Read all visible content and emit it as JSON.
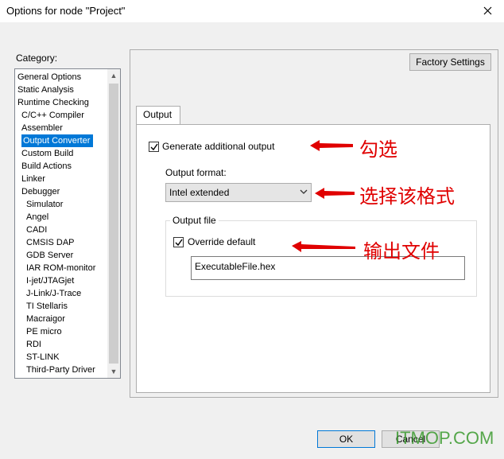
{
  "window": {
    "title": "Options for node \"Project\"",
    "close_icon": "close-icon"
  },
  "sidebar": {
    "label": "Category:",
    "items": [
      {
        "label": "General Options",
        "indent": 0
      },
      {
        "label": "Static Analysis",
        "indent": 0
      },
      {
        "label": "Runtime Checking",
        "indent": 0
      },
      {
        "label": "C/C++ Compiler",
        "indent": 1
      },
      {
        "label": "Assembler",
        "indent": 1
      },
      {
        "label": "Output Converter",
        "indent": 1,
        "selected": true
      },
      {
        "label": "Custom Build",
        "indent": 1
      },
      {
        "label": "Build Actions",
        "indent": 1
      },
      {
        "label": "Linker",
        "indent": 1
      },
      {
        "label": "Debugger",
        "indent": 1
      },
      {
        "label": "Simulator",
        "indent": 2
      },
      {
        "label": "Angel",
        "indent": 2
      },
      {
        "label": "CADI",
        "indent": 2
      },
      {
        "label": "CMSIS DAP",
        "indent": 2
      },
      {
        "label": "GDB Server",
        "indent": 2
      },
      {
        "label": "IAR ROM-monitor",
        "indent": 2
      },
      {
        "label": "I-jet/JTAGjet",
        "indent": 2
      },
      {
        "label": "J-Link/J-Trace",
        "indent": 2
      },
      {
        "label": "TI Stellaris",
        "indent": 2
      },
      {
        "label": "Macraigor",
        "indent": 2
      },
      {
        "label": "PE micro",
        "indent": 2
      },
      {
        "label": "RDI",
        "indent": 2
      },
      {
        "label": "ST-LINK",
        "indent": 2
      },
      {
        "label": "Third-Party Driver",
        "indent": 2
      }
    ]
  },
  "panel": {
    "factory_settings_label": "Factory Settings",
    "tab_label": "Output",
    "generate_output": {
      "label": "Generate additional output",
      "checked": true
    },
    "output_format": {
      "label": "Output format:",
      "value": "Intel extended"
    },
    "output_file": {
      "group_label": "Output file",
      "override": {
        "label": "Override default",
        "checked": true
      },
      "filename": "ExecutableFile.hex"
    }
  },
  "footer": {
    "ok_label": "OK",
    "cancel_label": "Cancel"
  },
  "annotations": {
    "check_note": "勾选",
    "format_note": "选择该格式",
    "file_note": "输出文件",
    "color": "#e00000"
  },
  "watermark": "ITMOP.COM",
  "colors": {
    "selection": "#0078d7",
    "dialog_bg": "#f0f0f0",
    "watermark": "#3a9a2e"
  }
}
